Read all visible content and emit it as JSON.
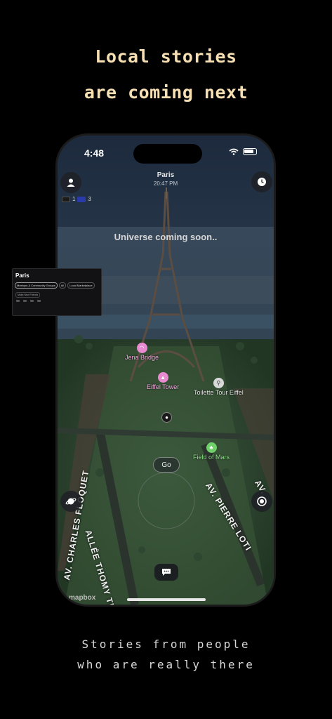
{
  "headline": {
    "line1": "Local stories",
    "line2": "are coming next"
  },
  "tagline": {
    "line1": "Stories from people",
    "line2": "who are really there"
  },
  "phone": {
    "status_time": "4:48",
    "city": "Paris",
    "local_time": "20:47 PM",
    "badges": {
      "count_a": "1",
      "count_b": "3"
    },
    "overlay_message": "Universe coming soon..",
    "go_label": "Go",
    "attribution": "mapbox",
    "pois": [
      {
        "name": "Jena Bridge",
        "color": "#e88ad0"
      },
      {
        "name": "Eiffel Tower",
        "color": "#e88ad0"
      },
      {
        "name": "Toilette Tour Eiffel",
        "color": "#d9d9d9"
      },
      {
        "name": "Field of Mars",
        "color": "#6fd16a"
      }
    ],
    "streets": [
      "ALLÉE THOMY THIERRY",
      "AV. PIERRE LOTI",
      "AV. CHARLES FLOQUET",
      "AV."
    ]
  },
  "panel": {
    "title": "Paris",
    "chips": [
      "Meetups & Community Groups",
      "All",
      "Local Marketplace"
    ],
    "sub_chip": "Make New Friends"
  },
  "colors": {
    "headline": "#f6dfb2",
    "tagline": "#d8d8d8",
    "poi_pink": "#e88ad0",
    "poi_green": "#6fd16a"
  }
}
